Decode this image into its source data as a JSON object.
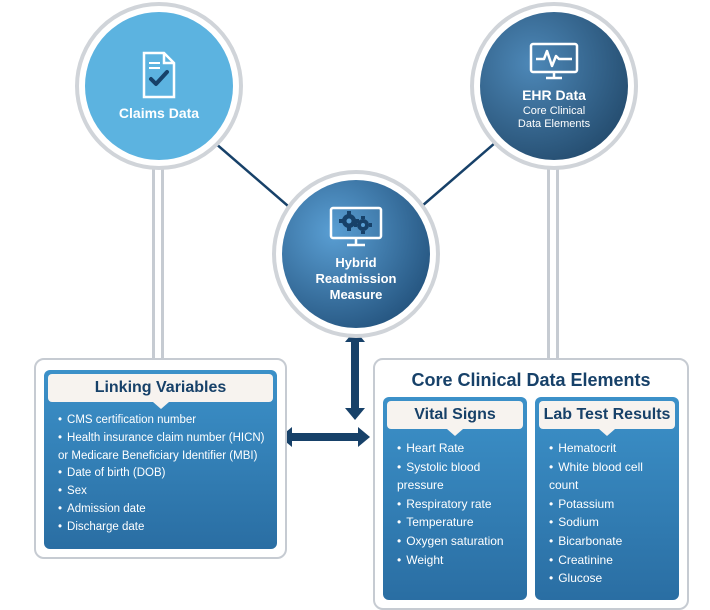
{
  "nodes": {
    "claims": {
      "title": "Claims Data"
    },
    "ehr": {
      "title": "EHR Data",
      "subtitle": "Core Clinical\nData Elements"
    },
    "hybrid": {
      "title": "Hybrid\nReadmission\nMeasure"
    }
  },
  "panels": {
    "linking": {
      "header": "Linking Variables",
      "items": [
        "CMS certification number",
        "Health insurance claim number (HICN) or Medicare Beneficiary Identifier (MBI)",
        "Date of birth (DOB)",
        "Sex",
        "Admission date",
        "Discharge date"
      ]
    },
    "clinical": {
      "title": "Core Clinical Data Elements",
      "vitals": {
        "header": "Vital Signs",
        "items": [
          "Heart Rate",
          "Systolic blood pressure",
          "Respiratory rate",
          "Temperature",
          "Oxygen saturation",
          "Weight"
        ]
      },
      "labs": {
        "header": "Lab Test Results",
        "items": [
          "Hematocrit",
          "White blood cell count",
          "Potassium",
          "Sodium",
          "Bicarbonate",
          "Creatinine",
          "Glucose"
        ]
      }
    }
  }
}
